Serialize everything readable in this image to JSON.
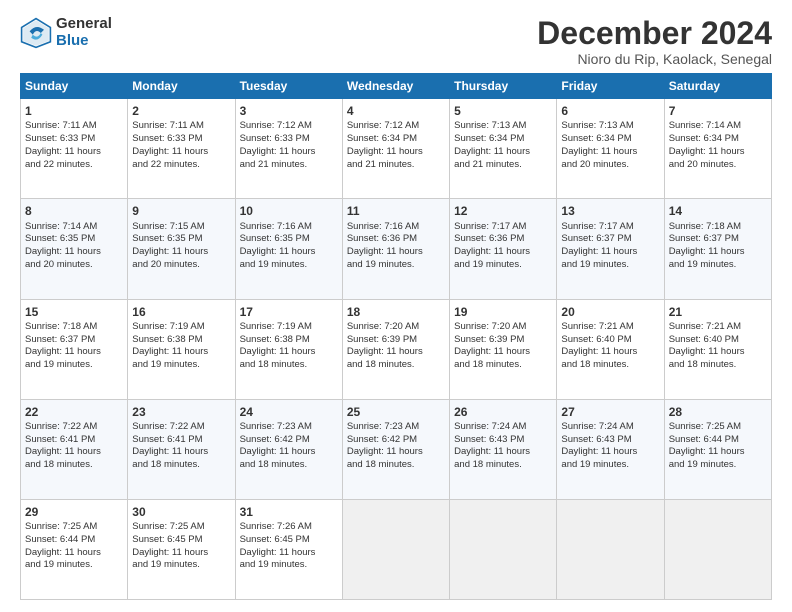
{
  "logo": {
    "general": "General",
    "blue": "Blue"
  },
  "header": {
    "title": "December 2024",
    "subtitle": "Nioro du Rip, Kaolack, Senegal"
  },
  "days_of_week": [
    "Sunday",
    "Monday",
    "Tuesday",
    "Wednesday",
    "Thursday",
    "Friday",
    "Saturday"
  ],
  "weeks": [
    [
      {
        "day": "1",
        "lines": [
          "Sunrise: 7:11 AM",
          "Sunset: 6:33 PM",
          "Daylight: 11 hours",
          "and 22 minutes."
        ]
      },
      {
        "day": "2",
        "lines": [
          "Sunrise: 7:11 AM",
          "Sunset: 6:33 PM",
          "Daylight: 11 hours",
          "and 22 minutes."
        ]
      },
      {
        "day": "3",
        "lines": [
          "Sunrise: 7:12 AM",
          "Sunset: 6:33 PM",
          "Daylight: 11 hours",
          "and 21 minutes."
        ]
      },
      {
        "day": "4",
        "lines": [
          "Sunrise: 7:12 AM",
          "Sunset: 6:34 PM",
          "Daylight: 11 hours",
          "and 21 minutes."
        ]
      },
      {
        "day": "5",
        "lines": [
          "Sunrise: 7:13 AM",
          "Sunset: 6:34 PM",
          "Daylight: 11 hours",
          "and 21 minutes."
        ]
      },
      {
        "day": "6",
        "lines": [
          "Sunrise: 7:13 AM",
          "Sunset: 6:34 PM",
          "Daylight: 11 hours",
          "and 20 minutes."
        ]
      },
      {
        "day": "7",
        "lines": [
          "Sunrise: 7:14 AM",
          "Sunset: 6:34 PM",
          "Daylight: 11 hours",
          "and 20 minutes."
        ]
      }
    ],
    [
      {
        "day": "8",
        "lines": [
          "Sunrise: 7:14 AM",
          "Sunset: 6:35 PM",
          "Daylight: 11 hours",
          "and 20 minutes."
        ]
      },
      {
        "day": "9",
        "lines": [
          "Sunrise: 7:15 AM",
          "Sunset: 6:35 PM",
          "Daylight: 11 hours",
          "and 20 minutes."
        ]
      },
      {
        "day": "10",
        "lines": [
          "Sunrise: 7:16 AM",
          "Sunset: 6:35 PM",
          "Daylight: 11 hours",
          "and 19 minutes."
        ]
      },
      {
        "day": "11",
        "lines": [
          "Sunrise: 7:16 AM",
          "Sunset: 6:36 PM",
          "Daylight: 11 hours",
          "and 19 minutes."
        ]
      },
      {
        "day": "12",
        "lines": [
          "Sunrise: 7:17 AM",
          "Sunset: 6:36 PM",
          "Daylight: 11 hours",
          "and 19 minutes."
        ]
      },
      {
        "day": "13",
        "lines": [
          "Sunrise: 7:17 AM",
          "Sunset: 6:37 PM",
          "Daylight: 11 hours",
          "and 19 minutes."
        ]
      },
      {
        "day": "14",
        "lines": [
          "Sunrise: 7:18 AM",
          "Sunset: 6:37 PM",
          "Daylight: 11 hours",
          "and 19 minutes."
        ]
      }
    ],
    [
      {
        "day": "15",
        "lines": [
          "Sunrise: 7:18 AM",
          "Sunset: 6:37 PM",
          "Daylight: 11 hours",
          "and 19 minutes."
        ]
      },
      {
        "day": "16",
        "lines": [
          "Sunrise: 7:19 AM",
          "Sunset: 6:38 PM",
          "Daylight: 11 hours",
          "and 19 minutes."
        ]
      },
      {
        "day": "17",
        "lines": [
          "Sunrise: 7:19 AM",
          "Sunset: 6:38 PM",
          "Daylight: 11 hours",
          "and 18 minutes."
        ]
      },
      {
        "day": "18",
        "lines": [
          "Sunrise: 7:20 AM",
          "Sunset: 6:39 PM",
          "Daylight: 11 hours",
          "and 18 minutes."
        ]
      },
      {
        "day": "19",
        "lines": [
          "Sunrise: 7:20 AM",
          "Sunset: 6:39 PM",
          "Daylight: 11 hours",
          "and 18 minutes."
        ]
      },
      {
        "day": "20",
        "lines": [
          "Sunrise: 7:21 AM",
          "Sunset: 6:40 PM",
          "Daylight: 11 hours",
          "and 18 minutes."
        ]
      },
      {
        "day": "21",
        "lines": [
          "Sunrise: 7:21 AM",
          "Sunset: 6:40 PM",
          "Daylight: 11 hours",
          "and 18 minutes."
        ]
      }
    ],
    [
      {
        "day": "22",
        "lines": [
          "Sunrise: 7:22 AM",
          "Sunset: 6:41 PM",
          "Daylight: 11 hours",
          "and 18 minutes."
        ]
      },
      {
        "day": "23",
        "lines": [
          "Sunrise: 7:22 AM",
          "Sunset: 6:41 PM",
          "Daylight: 11 hours",
          "and 18 minutes."
        ]
      },
      {
        "day": "24",
        "lines": [
          "Sunrise: 7:23 AM",
          "Sunset: 6:42 PM",
          "Daylight: 11 hours",
          "and 18 minutes."
        ]
      },
      {
        "day": "25",
        "lines": [
          "Sunrise: 7:23 AM",
          "Sunset: 6:42 PM",
          "Daylight: 11 hours",
          "and 18 minutes."
        ]
      },
      {
        "day": "26",
        "lines": [
          "Sunrise: 7:24 AM",
          "Sunset: 6:43 PM",
          "Daylight: 11 hours",
          "and 18 minutes."
        ]
      },
      {
        "day": "27",
        "lines": [
          "Sunrise: 7:24 AM",
          "Sunset: 6:43 PM",
          "Daylight: 11 hours",
          "and 19 minutes."
        ]
      },
      {
        "day": "28",
        "lines": [
          "Sunrise: 7:25 AM",
          "Sunset: 6:44 PM",
          "Daylight: 11 hours",
          "and 19 minutes."
        ]
      }
    ],
    [
      {
        "day": "29",
        "lines": [
          "Sunrise: 7:25 AM",
          "Sunset: 6:44 PM",
          "Daylight: 11 hours",
          "and 19 minutes."
        ]
      },
      {
        "day": "30",
        "lines": [
          "Sunrise: 7:25 AM",
          "Sunset: 6:45 PM",
          "Daylight: 11 hours",
          "and 19 minutes."
        ]
      },
      {
        "day": "31",
        "lines": [
          "Sunrise: 7:26 AM",
          "Sunset: 6:45 PM",
          "Daylight: 11 hours",
          "and 19 minutes."
        ]
      },
      {
        "day": "",
        "lines": []
      },
      {
        "day": "",
        "lines": []
      },
      {
        "day": "",
        "lines": []
      },
      {
        "day": "",
        "lines": []
      }
    ]
  ]
}
